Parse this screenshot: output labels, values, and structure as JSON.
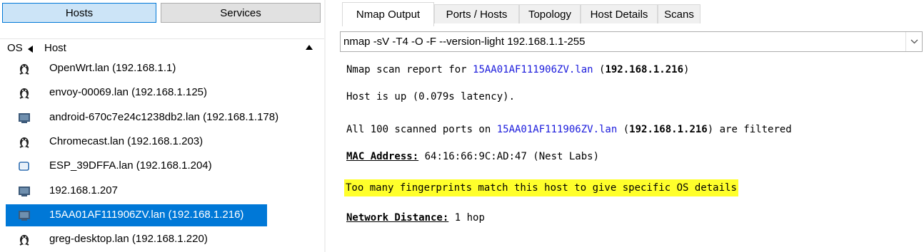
{
  "left_pane": {
    "hosts_button": "Hosts",
    "services_button": "Services",
    "col_os": "OS",
    "col_host": "Host",
    "hosts": [
      {
        "label": "OpenWrt.lan (192.168.1.1)",
        "os_icon": "linux-penguin-icon",
        "selected": false
      },
      {
        "label": "envoy-00069.lan (192.168.1.125)",
        "os_icon": "linux-penguin-icon",
        "selected": false
      },
      {
        "label": "android-670c7e24c1238db2.lan (192.168.1.178)",
        "os_icon": "unknown-os-icon",
        "selected": false
      },
      {
        "label": "Chromecast.lan (192.168.1.203)",
        "os_icon": "linux-penguin-icon",
        "selected": false
      },
      {
        "label": "ESP_39DFFA.lan (192.168.1.204)",
        "os_icon": "device-icon",
        "selected": false
      },
      {
        "label": "192.168.1.207",
        "os_icon": "unknown-os-icon",
        "selected": false
      },
      {
        "label": "15AA01AF111906ZV.lan (192.168.1.216)",
        "os_icon": "unknown-os-icon",
        "selected": true
      },
      {
        "label": "greg-desktop.lan (192.168.1.220)",
        "os_icon": "linux-penguin-icon",
        "selected": false
      }
    ]
  },
  "right_pane": {
    "tabs": [
      "Nmap Output",
      "Ports / Hosts",
      "Topology",
      "Host Details",
      "Scans"
    ],
    "active_tab": "Nmap Output",
    "command": "nmap -sV -T4 -O -F --version-light 192.168.1.1-255",
    "output": {
      "l1_prefix": "Nmap scan report for ",
      "l1_host": "15AA01AF111906ZV.lan",
      "l1_paren_open": " (",
      "l1_ip": "192.168.1.216",
      "l1_paren_close": ")",
      "l2": "Host is up (0.079s latency).",
      "l3_prefix": "All 100 scanned ports on ",
      "l3_host": "15AA01AF111906ZV.lan",
      "l3_paren_open": " (",
      "l3_ip": "192.168.1.216",
      "l3_suffix": ") are filtered",
      "mac_label": "MAC Address:",
      "mac_value": " 64:16:66:9C:AD:47 (Nest Labs)",
      "os_line": "Too many fingerprints match this host to give specific OS details",
      "dist_label": "Network Distance:",
      "dist_value": " 1 hop"
    }
  },
  "colors": {
    "selected_row": "#0078d7",
    "hosts_button_bg": "#cce4f7",
    "link_blue": "#1a1adc",
    "highlight": "#ffff2b"
  }
}
